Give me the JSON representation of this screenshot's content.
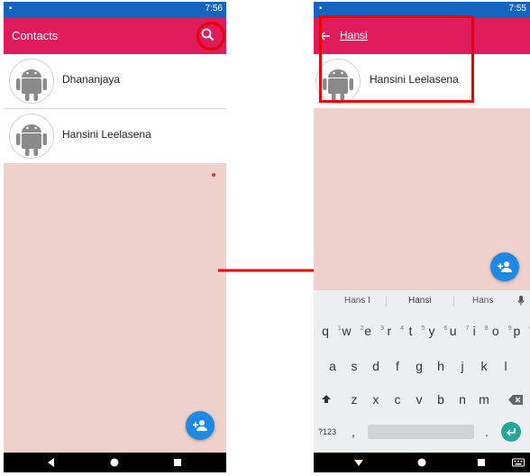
{
  "left_screen": {
    "status_time": "7:56",
    "appbar_title": "Contacts",
    "contacts": [
      {
        "name": "Dhananjaya"
      },
      {
        "name": "Hansini Leelasena"
      }
    ]
  },
  "right_screen": {
    "status_time": "7:55",
    "search_query": "Hansi",
    "results": [
      {
        "name": "Hansini Leelasena"
      }
    ],
    "keyboard": {
      "suggestions": [
        "Hans I",
        "Hansi",
        "Hans"
      ],
      "row1": [
        {
          "k": "q",
          "n": "1"
        },
        {
          "k": "w",
          "n": "2"
        },
        {
          "k": "e",
          "n": "3"
        },
        {
          "k": "r",
          "n": "4"
        },
        {
          "k": "t",
          "n": "5"
        },
        {
          "k": "y",
          "n": "6"
        },
        {
          "k": "u",
          "n": "7"
        },
        {
          "k": "i",
          "n": "8"
        },
        {
          "k": "o",
          "n": "9"
        },
        {
          "k": "p",
          "n": "0"
        }
      ],
      "row2": [
        "a",
        "s",
        "d",
        "f",
        "g",
        "h",
        "j",
        "k",
        "l"
      ],
      "row3": [
        "z",
        "x",
        "c",
        "v",
        "b",
        "n",
        "m"
      ],
      "symbols_label": "?123",
      "comma": ",",
      "period": "."
    }
  },
  "colors": {
    "appbar": "#e01b5b",
    "statusbar": "#1565c0",
    "background": "#efd1cb",
    "fab": "#1e88e5",
    "annotation": "#e80000"
  },
  "icons": [
    "search-icon",
    "back-arrow-icon",
    "add-person-icon",
    "android-icon",
    "mic-icon",
    "backspace-icon",
    "shift-icon",
    "enter-icon",
    "keyboard-switch-icon"
  ]
}
